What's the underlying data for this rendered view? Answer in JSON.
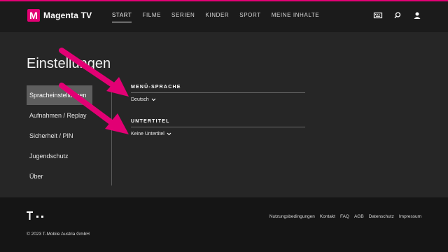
{
  "brand": {
    "logo_letter": "M",
    "name": "Magenta TV",
    "accent": "#e20074"
  },
  "nav": {
    "items": [
      "START",
      "FILME",
      "SERIEN",
      "KINDER",
      "SPORT",
      "MEINE INHALTE"
    ],
    "active": "START"
  },
  "header_icons": [
    "keyboard-icon",
    "search-icon",
    "user-icon"
  ],
  "page": {
    "title": "Einstellungen"
  },
  "sidebar": {
    "items": [
      {
        "label": "Spracheinstellungen"
      },
      {
        "label": "Aufnahmen / Replay"
      },
      {
        "label": "Sicherheit / PIN"
      },
      {
        "label": "Jugendschutz"
      },
      {
        "label": "Über"
      }
    ],
    "active": "Spracheinstellungen"
  },
  "settings": {
    "menu_language": {
      "heading": "MENÜ-SPRACHE",
      "value": "Deutsch"
    },
    "subtitles": {
      "heading": "UNTERTITEL",
      "value": "Keine Untertitel"
    }
  },
  "footer": {
    "links": [
      "Nutzungsbedingungen",
      "Kontakt",
      "FAQ",
      "AGB",
      "Datenschutz",
      "Impressum"
    ],
    "copyright": "© 2023 T-Mobile Austria GmbH"
  }
}
